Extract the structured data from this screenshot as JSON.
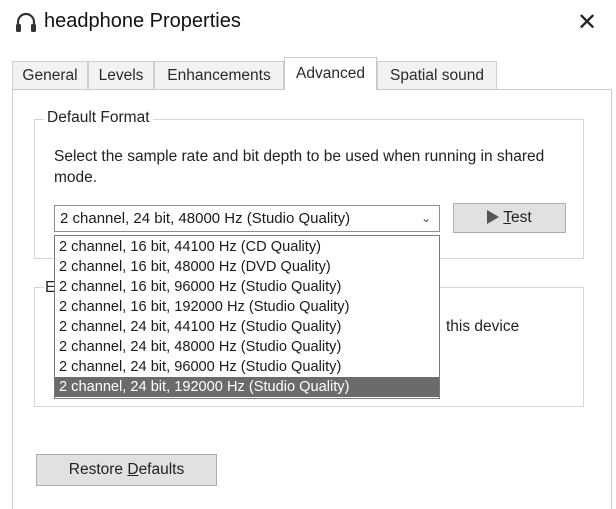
{
  "window": {
    "title": "headphone Properties",
    "close_glyph": "✕",
    "icon": "headphone-icon"
  },
  "tabs": [
    {
      "label": "General",
      "active": false
    },
    {
      "label": "Levels",
      "active": false
    },
    {
      "label": "Enhancements",
      "active": false
    },
    {
      "label": "Advanced",
      "active": true
    },
    {
      "label": "Spatial sound",
      "active": false
    }
  ],
  "default_format": {
    "group_title": "Default Format",
    "description": "Select the sample rate and bit depth to be used when running in shared mode.",
    "selected_value": "2 channel, 24 bit, 48000 Hz (Studio Quality)",
    "test_button": {
      "before": "",
      "underlined": "T",
      "after": "est"
    },
    "options": [
      "2 channel, 16 bit, 44100 Hz (CD Quality)",
      "2 channel, 16 bit, 48000 Hz (DVD Quality)",
      "2 channel, 16 bit, 96000 Hz (Studio Quality)",
      "2 channel, 16 bit, 192000 Hz (Studio Quality)",
      "2 channel, 24 bit, 44100 Hz (Studio Quality)",
      "2 channel, 24 bit, 48000 Hz (Studio Quality)",
      "2 channel, 24 bit, 96000 Hz (Studio Quality)",
      "2 channel, 24 bit, 192000 Hz (Studio Quality)"
    ],
    "highlighted_option": "2 channel, 24 bit, 192000 Hz (Studio Quality)"
  },
  "exclusive_mode": {
    "group_title_visible": "E",
    "visible_text": "this device"
  },
  "restore_button": {
    "before": "Restore ",
    "underlined": "D",
    "after": "efaults"
  },
  "colors": {
    "highlight_bg": "#6b6b6b",
    "button_bg": "#e1e1e1"
  }
}
